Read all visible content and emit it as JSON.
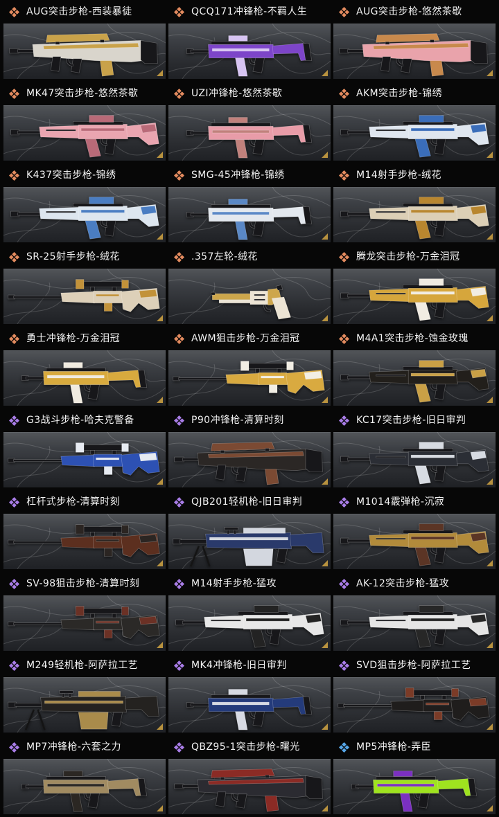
{
  "items": [
    {
      "label": "AUG突击步枪-西装暴徒",
      "icon_color": "#e48b5f",
      "art": "bullpup-rifle-icon",
      "colors": [
        "#d9d5cc",
        "#c9a24a"
      ]
    },
    {
      "label": "QCQ171冲锋枪-不羁人生",
      "icon_color": "#e48b5f",
      "art": "smg-icon",
      "colors": [
        "#7d45c9",
        "#d7c4f2"
      ]
    },
    {
      "label": "AUG突击步枪-悠然茶歇",
      "icon_color": "#e48b5f",
      "art": "bullpup-rifle-icon",
      "colors": [
        "#e9a3ab",
        "#c8894c"
      ]
    },
    {
      "label": "MK47突击步枪-悠然茶歇",
      "icon_color": "#e48b5f",
      "art": "assault-rifle-icon",
      "colors": [
        "#eaa5b0",
        "#b96a78"
      ]
    },
    {
      "label": "UZI冲锋枪-悠然茶歇",
      "icon_color": "#e48b5f",
      "art": "smg-icon",
      "colors": [
        "#e89ca8",
        "#c1817c"
      ]
    },
    {
      "label": "AKM突击步枪-锦绣",
      "icon_color": "#e48b5f",
      "art": "assault-rifle-icon",
      "colors": [
        "#dfe6ef",
        "#3a6db9"
      ]
    },
    {
      "label": "K437突击步枪-锦绣",
      "icon_color": "#e48b5f",
      "art": "assault-rifle-icon",
      "colors": [
        "#dde6ef",
        "#4a7dc2"
      ]
    },
    {
      "label": "SMG-45冲锋枪-锦绣",
      "icon_color": "#e48b5f",
      "art": "smg-icon",
      "colors": [
        "#e3e8ee",
        "#5a88c6"
      ]
    },
    {
      "label": "M14射手步枪-绒花",
      "icon_color": "#e48b5f",
      "art": "assault-rifle-icon",
      "colors": [
        "#dccfb6",
        "#b8862f"
      ]
    },
    {
      "label": "SR-25射手步枪-绒花",
      "icon_color": "#e48b5f",
      "art": "sniper-rifle-icon",
      "colors": [
        "#ddd0b9",
        "#c2923a"
      ]
    },
    {
      "label": ".357左轮-绒花",
      "icon_color": "#e48b5f",
      "art": "revolver-icon",
      "colors": [
        "#cda64c",
        "#ece4d4"
      ]
    },
    {
      "label": "腾龙突击步枪-万金泪冠",
      "icon_color": "#e48b5f",
      "art": "assault-rifle-icon",
      "colors": [
        "#d6a63c",
        "#f1ece2"
      ]
    },
    {
      "label": "勇士冲锋枪-万金泪冠",
      "icon_color": "#e48b5f",
      "art": "smg-icon",
      "colors": [
        "#d8aa3e",
        "#f0ebe0"
      ]
    },
    {
      "label": "AWM狙击步枪-万金泪冠",
      "icon_color": "#e48b5f",
      "art": "sniper-rifle-icon",
      "colors": [
        "#d9aa40",
        "#f2eee4"
      ]
    },
    {
      "label": "M4A1突击步枪-蚀金玫瑰",
      "icon_color": "#e48b5f",
      "art": "assault-rifle-icon",
      "colors": [
        "#221f1b",
        "#c9a046"
      ]
    },
    {
      "label": "G3战斗步枪-哈夫克警备",
      "icon_color": "#a97de8",
      "art": "sniper-rifle-icon",
      "colors": [
        "#2d51b3",
        "#e6eaf1"
      ]
    },
    {
      "label": "P90冲锋枪-清算时刻",
      "icon_color": "#a97de8",
      "art": "bullpup-rifle-icon",
      "colors": [
        "#2b2725",
        "#7b4a33"
      ]
    },
    {
      "label": "KC17突击步枪-旧日审判",
      "icon_color": "#a97de8",
      "art": "assault-rifle-icon",
      "colors": [
        "#2b2e35",
        "#d7dbe2"
      ]
    },
    {
      "label": "杠杆式步枪-清算时刻",
      "icon_color": "#a97de8",
      "art": "sniper-rifle-icon",
      "colors": [
        "#5c2f1f",
        "#2b2522"
      ]
    },
    {
      "label": "QJB201轻机枪-旧日审判",
      "icon_color": "#a97de8",
      "art": "lmg-icon",
      "colors": [
        "#2a3a6b",
        "#d3d7df"
      ]
    },
    {
      "label": "M1014霰弹枪-沉寂",
      "icon_color": "#a97de8",
      "art": "assault-rifle-icon",
      "colors": [
        "#b28b3b",
        "#5b3525"
      ]
    },
    {
      "label": "SV-98狙击步枪-清算时刻",
      "icon_color": "#a97de8",
      "art": "sniper-rifle-icon",
      "colors": [
        "#2b2927",
        "#6b3125"
      ]
    },
    {
      "label": "M14射手步枪-猛攻",
      "icon_color": "#a97de8",
      "art": "assault-rifle-icon",
      "colors": [
        "#e7e7e7",
        "#232323"
      ]
    },
    {
      "label": "AK-12突击步枪-猛攻",
      "icon_color": "#a97de8",
      "art": "assault-rifle-icon",
      "colors": [
        "#e5e5e5",
        "#272727"
      ]
    },
    {
      "label": "M249轻机枪-阿萨拉工艺",
      "icon_color": "#a97de8",
      "art": "lmg-icon",
      "colors": [
        "#242220",
        "#a98b4b"
      ]
    },
    {
      "label": "MK4冲锋枪-旧日审判",
      "icon_color": "#a97de8",
      "art": "smg-icon",
      "colors": [
        "#243b7b",
        "#d7dae3"
      ]
    },
    {
      "label": "SVD狙击步枪-阿萨拉工艺",
      "icon_color": "#a97de8",
      "art": "sniper-rifle-icon",
      "colors": [
        "#1f1d1c",
        "#7b3b27"
      ]
    },
    {
      "label": "MP7冲锋枪-六套之力",
      "icon_color": "#a97de8",
      "art": "smg-icon",
      "colors": [
        "#a18b61",
        "#2b2723"
      ]
    },
    {
      "label": "QBZ95-1突击步枪-曙光",
      "icon_color": "#a97de8",
      "art": "bullpup-rifle-icon",
      "colors": [
        "#2b2b31",
        "#8b2b25"
      ]
    },
    {
      "label": "MP5冲锋枪-弄臣",
      "icon_color": "#56a6e8",
      "art": "smg-icon",
      "colors": [
        "#9fe31f",
        "#7b30c1"
      ]
    }
  ]
}
